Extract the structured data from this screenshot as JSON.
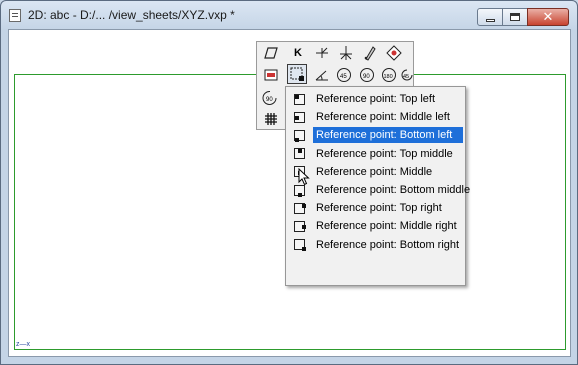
{
  "window": {
    "title": "2D: abc - D:/... /view_sheets/XYZ.vxp *",
    "minimize_icon": "minimize-icon",
    "maximize_icon": "maximize-icon",
    "close_icon": "close-icon",
    "close_glyph": "✕"
  },
  "canvas": {
    "axis_label": "z—x",
    "frame_color": "#2d9b2d"
  },
  "palette": {
    "tools": [
      "parallelogram-icon",
      "k-icon",
      "angle-icon",
      "cross-icon",
      "pen-icon",
      "tag-icon",
      "region-icon",
      "reference-point-icon",
      "dimension-angle-icon",
      "rotate-45-icon",
      "rotate-90-icon",
      "rotate-180-icon",
      "rotate-45-ccw-icon",
      "rotate-90-ccw-icon",
      "grid-icon"
    ],
    "labels": {
      "k": "K",
      "r45": "45",
      "r90": "90",
      "r180": "180",
      "r45b": "45",
      "r90b": "90"
    }
  },
  "menu": {
    "items": [
      {
        "label": "Reference point: Top left",
        "pos": "top-left"
      },
      {
        "label": "Reference point: Middle left",
        "pos": "middle-left"
      },
      {
        "label": "Reference point: Bottom left",
        "pos": "bottom-left",
        "selected": true
      },
      {
        "label": "Reference point: Top middle",
        "pos": "top-middle"
      },
      {
        "label": "Reference point: Middle",
        "pos": "middle"
      },
      {
        "label": "Reference point: Bottom middle",
        "pos": "bottom-middle"
      },
      {
        "label": "Reference point: Top right",
        "pos": "top-right"
      },
      {
        "label": "Reference point: Middle right",
        "pos": "middle-right"
      },
      {
        "label": "Reference point: Bottom right",
        "pos": "bottom-right"
      }
    ],
    "selected_color": "#1e6fd9"
  }
}
